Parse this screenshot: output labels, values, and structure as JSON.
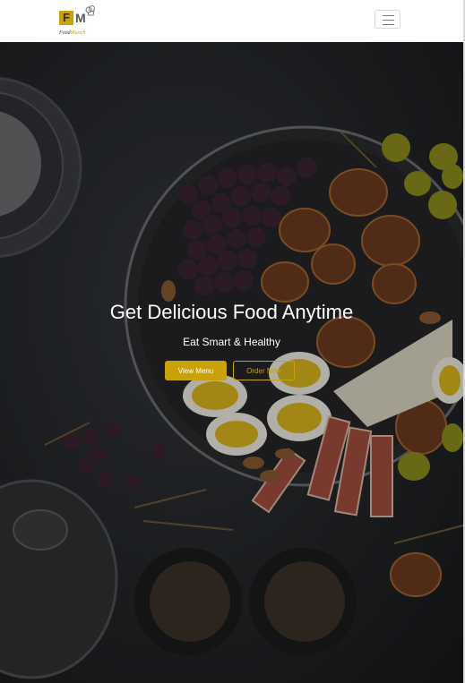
{
  "navbar": {
    "brand": {
      "letter_f": "F",
      "letter_m": "M",
      "wordmark_part1": "Food",
      "wordmark_part2": "Munch"
    },
    "toggler_icon": "hamburger-menu-icon"
  },
  "hero": {
    "title": "Get Delicious Food Anytime",
    "subtitle": "Eat Smart & Healthy",
    "primary_button": "View Menu",
    "secondary_button": "Order Now"
  },
  "colors": {
    "accent": "#c9a20a",
    "navbar_bg": "#ffffff",
    "hero_text": "#ffffff",
    "hero_bg": "#1e1f21"
  }
}
